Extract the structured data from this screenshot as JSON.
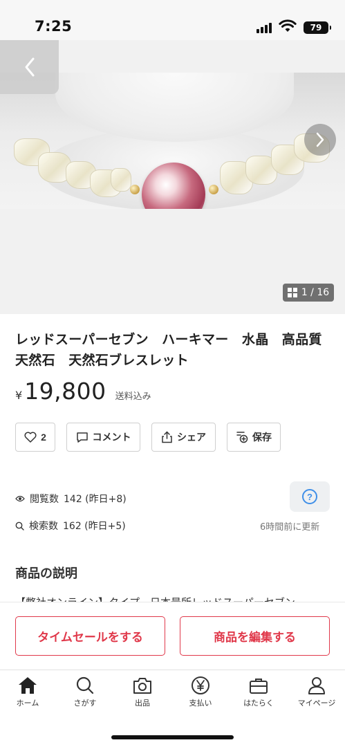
{
  "status_bar": {
    "time": "7:25",
    "battery": "79"
  },
  "carousel": {
    "counter": "1 / 16"
  },
  "product": {
    "title": "レッドスーパーセブン　ハーキマー　水晶　高品質　天然石　天然石ブレスレット",
    "currency": "¥",
    "price": "19,800",
    "shipping": "送料込み"
  },
  "actions": {
    "like_count": "2",
    "comment_label": "コメント",
    "share_label": "シェア",
    "save_label": "保存"
  },
  "stats": {
    "views_label": "閲覧数",
    "views_value": "142 (昨日+8)",
    "search_label": "検索数",
    "search_value": "162 (昨日+5)",
    "help_symbol": "?",
    "updated": "6時間前に更新"
  },
  "description": {
    "heading": "商品の説明",
    "peek": "【弊社オンライン】タイプ　日本最所レッドスーパーセブン"
  },
  "cta": {
    "time_sale": "タイムセールをする",
    "edit": "商品を編集する"
  },
  "tabs": [
    {
      "label": "ホーム",
      "icon": "home-icon"
    },
    {
      "label": "さがす",
      "icon": "search-icon"
    },
    {
      "label": "出品",
      "icon": "camera-icon"
    },
    {
      "label": "支払い",
      "icon": "yen-icon"
    },
    {
      "label": "はたらく",
      "icon": "briefcase-icon"
    },
    {
      "label": "マイページ",
      "icon": "person-icon"
    }
  ],
  "colors": {
    "accent": "#e0384a",
    "help_blue": "#3f8fe8"
  }
}
